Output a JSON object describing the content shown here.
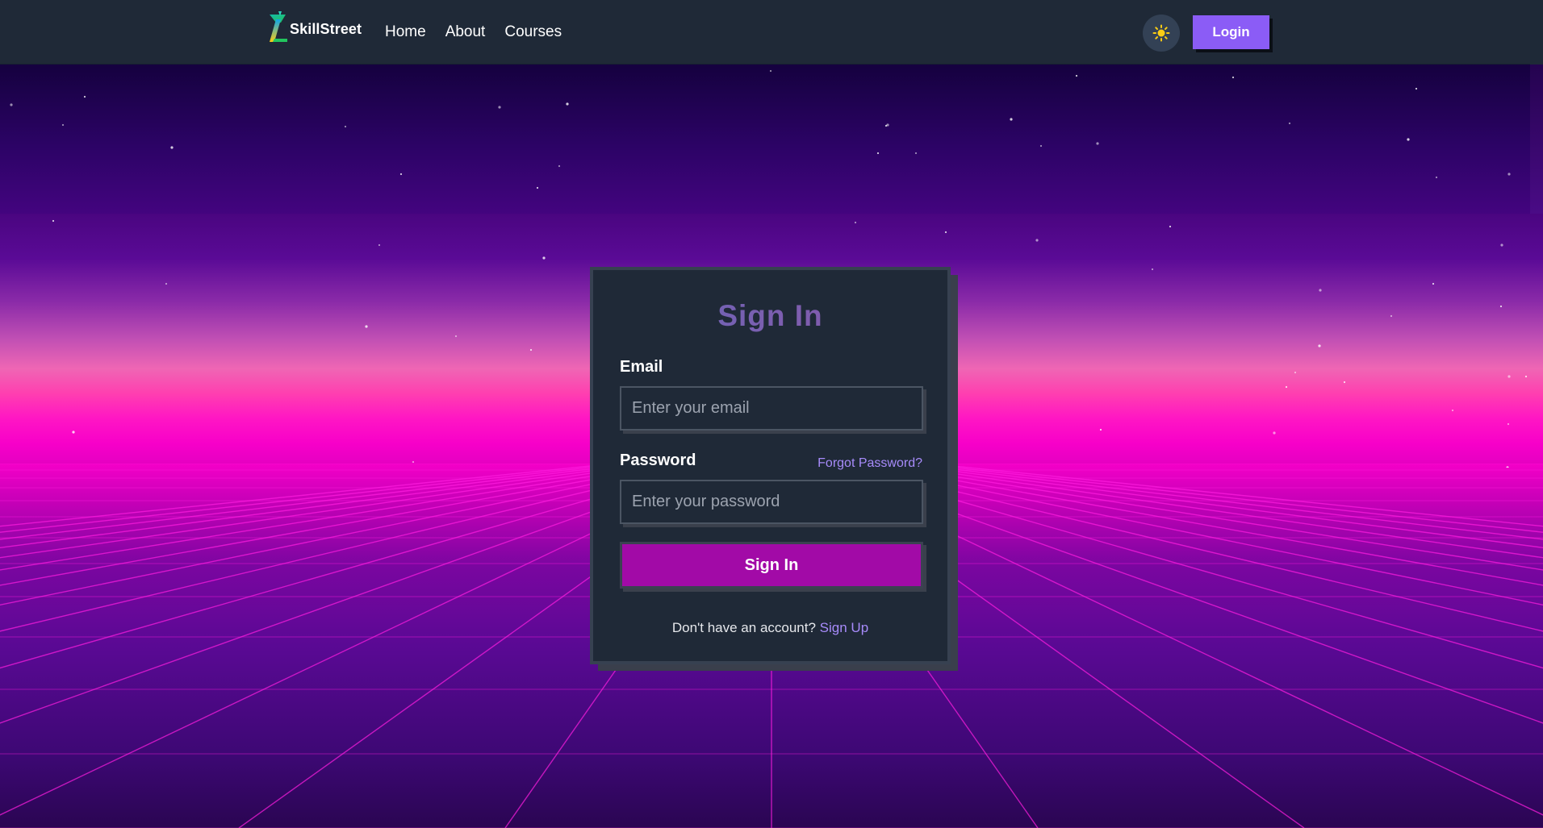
{
  "nav": {
    "brand": "SkillStreet",
    "links": [
      "Home",
      "About",
      "Courses"
    ],
    "login_label": "Login"
  },
  "form": {
    "title": "Sign In",
    "email_label": "Email",
    "email_placeholder": "Enter your email",
    "password_label": "Password",
    "forgot_label": "Forgot Password?",
    "password_placeholder": "Enter your password",
    "submit_label": "Sign In",
    "signup_prompt": "Don't have an account?",
    "signup_label": "Sign Up"
  },
  "colors": {
    "accent": "#8b5cf6",
    "submit": "#a20aa7",
    "link": "#a78bfa",
    "card": "#1f2937",
    "grid_line": "#ff1ee0"
  },
  "icons": {
    "theme_toggle": "sun-icon",
    "logo": "skillstreet-logo-icon"
  }
}
